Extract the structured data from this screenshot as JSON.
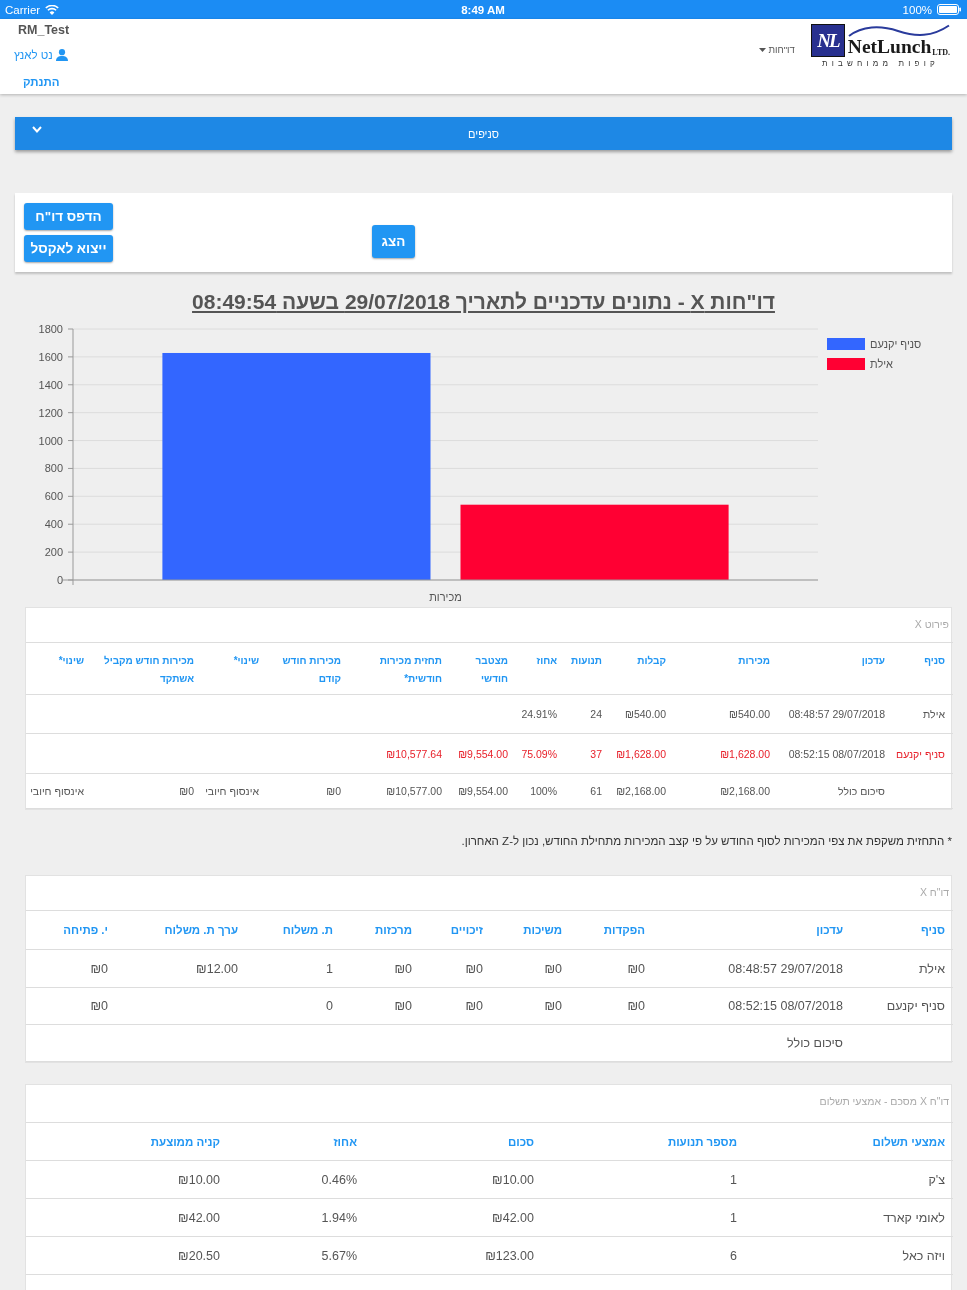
{
  "status_bar": {
    "carrier": "Carrier",
    "time": "8:49 AM",
    "battery": "100%"
  },
  "header": {
    "store": "RM_Test",
    "user": "נט לאנץ",
    "logout": "התנתק",
    "menu": "דו\"חות",
    "logo": {
      "mark": "NL",
      "name": "NetLunch",
      "suffix": "LTD.",
      "tagline": "קופות ממוחשבות"
    }
  },
  "branches_bar": {
    "label": "סניפים",
    "expanded": false
  },
  "actions": {
    "buttons": [
      "הדפס דו\"ח",
      "ייצוא לאקסל"
    ],
    "show": "הצג"
  },
  "report": {
    "title": "דו\"חות X - נתונים עדכניים לתאריך 29/07/2018 בשעה 08:49:54",
    "chart_data": {
      "type": "bar",
      "categories": [
        "מכירות"
      ],
      "series": [
        {
          "name": "סניף יקנעם",
          "color": "#3366ff",
          "values": [
            1628
          ]
        },
        {
          "name": "אילת",
          "color": "#ff0033",
          "values": [
            540
          ]
        }
      ],
      "ylim": [
        0,
        1800
      ],
      "yticks": [
        {
          "value": 0,
          "label": "0"
        },
        200,
        400,
        600,
        800,
        1000,
        1200,
        1400,
        1600,
        1800
      ],
      "grid": true,
      "legend": "right"
    }
  },
  "sales_table": {
    "title": "פירוט X",
    "columns": [
      {
        "label": "סניף",
        "kind": "text"
      },
      {
        "label": "עדכון",
        "kind": "date"
      },
      {
        "label": "מכירות",
        "kind": "text"
      },
      {
        "label": "קבלות",
        "kind": "text"
      },
      {
        "label": "תנועות",
        "kind": "text"
      },
      {
        "label": "אחוז",
        "kind": "text"
      },
      {
        "label": "מצטבר חודשי",
        "kind": "text"
      },
      {
        "label": "תחזית מכירות חודשית*",
        "kind": "text"
      },
      {
        "label": "מכירות חודש קודם",
        "kind": "text"
      },
      {
        "label": "שינוי*",
        "kind": "text"
      },
      {
        "label": "מכירות חודש מקביל אשתקד",
        "kind": "text"
      },
      {
        "label": "שינוי*",
        "kind": "text"
      }
    ],
    "rows": [
      {
        "highlighted": false,
        "cells": [
          "אילת",
          "08:48:57 29/07/2018",
          "₪540.00",
          "₪540.00",
          "24",
          "24.91%",
          null,
          null,
          null,
          null,
          null,
          null
        ]
      },
      {
        "highlighted": true,
        "cells": [
          "סניף יקנעם",
          "08:52:15 08/07/2018",
          "₪1,628.00",
          "₪1,628.00",
          "37",
          "75.09%",
          "₪9,554.00",
          "₪10,577.64",
          null,
          null,
          null,
          null
        ]
      },
      {
        "highlighted": false,
        "cells": [
          null,
          "סיכום כולל",
          "₪2,168.00",
          "₪2,168.00",
          "61",
          "100%",
          "₪9,554.00",
          "₪10,577.00",
          "₪0",
          "אינסוף חיובי",
          "₪0",
          "אינסוף חיובי"
        ]
      }
    ]
  },
  "footnote": "* התחזית משקפת את צפי המכירות לסוף החודש על פי קצב המכירות מתחילת החודש, נכון ל-Z האחרון.",
  "x_table": {
    "title": "דו\"ח X",
    "columns": [
      {
        "label": "סניף",
        "kind": "text"
      },
      {
        "label": "עדכון",
        "kind": "date"
      },
      {
        "label": "הפקדות",
        "kind": "text"
      },
      {
        "label": "משיכות",
        "kind": "text"
      },
      {
        "label": "זיכויים",
        "kind": "text"
      },
      {
        "label": "מרכזות",
        "kind": "text"
      },
      {
        "label": "ת. משלוח",
        "kind": "text"
      },
      {
        "label": "ערך ת. משלוח",
        "kind": "text"
      },
      {
        "label": "י. פתיחה",
        "kind": "text"
      }
    ],
    "rows": [
      {
        "cells": [
          "אילת",
          "08:48:57 29/07/2018",
          "₪0",
          "₪0",
          "₪0",
          "₪0",
          "1",
          "₪12.00",
          "₪0"
        ]
      },
      {
        "cells": [
          "סניף יקנעם",
          "08:52:15 08/07/2018",
          "₪0",
          "₪0",
          "₪0",
          "₪0",
          "0",
          null,
          "₪0"
        ]
      },
      {
        "cells": [
          null,
          "סיכום כולל",
          null,
          null,
          null,
          null,
          null,
          null,
          null
        ]
      }
    ]
  },
  "payments_table": {
    "title": "דו\"ח X מסכם - אמצעי תשלום",
    "columns": [
      {
        "label": "אמצעי תשלום"
      },
      {
        "label": "מספר תנועות"
      },
      {
        "label": "סכום"
      },
      {
        "label": "אחוז"
      },
      {
        "label": "קניה ממוצעת"
      }
    ],
    "rows": [
      {
        "cells": [
          "צ'ק",
          "1",
          "₪10.00",
          "0.46%",
          "₪10.00"
        ]
      },
      {
        "cells": [
          "לאומי קארד",
          "1",
          "₪42.00",
          "1.94%",
          "₪42.00"
        ]
      },
      {
        "cells": [
          "ויזה כאל",
          "6",
          "₪123.00",
          "5.67%",
          "₪20.50"
        ]
      }
    ]
  }
}
